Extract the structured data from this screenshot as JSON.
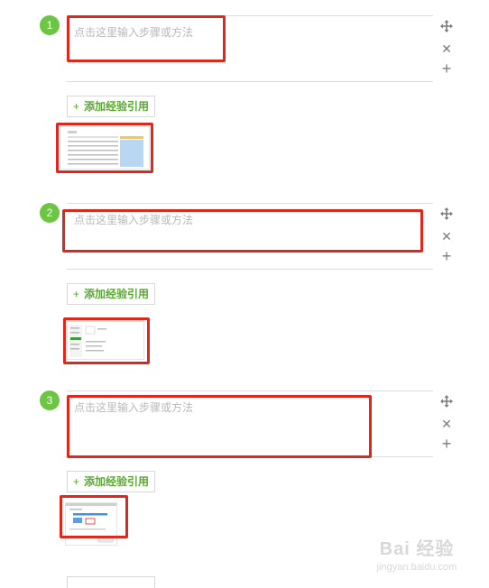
{
  "steps": [
    {
      "number": "1",
      "placeholder": "点击这里输入步骤或方法",
      "reference_label": "添加经验引用"
    },
    {
      "number": "2",
      "placeholder": "点击这里输入步骤或方法",
      "reference_label": "添加经验引用"
    },
    {
      "number": "3",
      "placeholder": "点击这里输入步骤或方法",
      "reference_label": "添加经验引用"
    }
  ],
  "tools": {
    "move_icon": "move-icon",
    "remove_icon": "close-icon",
    "add_icon": "plus-icon"
  },
  "colors": {
    "step_badge": "#6cc644",
    "reference_text": "#5aa832",
    "highlight": "#e0271c",
    "placeholder": "#b8b8b8"
  },
  "watermark": {
    "brand": "Bai 经验",
    "url": "jingyan.baidu.com"
  }
}
